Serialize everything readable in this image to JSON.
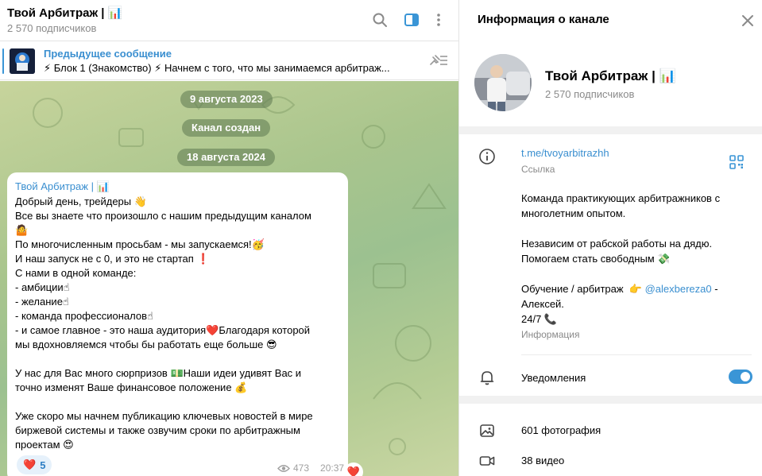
{
  "chat": {
    "title": "Твой Арбитраж | 📊",
    "subscribers": "2 570 подписчиков",
    "header_icons": [
      "search-icon",
      "sidebar-toggle-icon",
      "more-vertical-icon"
    ]
  },
  "pinned": {
    "title": "Предыдущее сообщение",
    "text": "⚡ Блок 1 (Знакомство) ⚡  Начнем с того, что мы занимаемся арбитраж..."
  },
  "service_messages": [
    "9 августа 2023",
    "Канал создан",
    "18 августа 2024"
  ],
  "post": {
    "author": "Твой Арбитраж | 📊",
    "lines": [
      "Добрый день, трейдеры 👋",
      "Все вы знаете что произошло с нашим предыдущим каналом",
      "🤷",
      "По многочисленным просьбам - мы запускаемся!🥳",
      "И наш запуск не с 0, и это не стартап ❗",
      "С нами в одной команде:",
      "- амбиции☝",
      "- желание☝",
      "- команда профессионалов☝",
      "- и самое главное - это наша аудитория❤️Благодаря которой",
      "мы вдохновляемся чтобы бы работать еще больше 😎",
      "",
      "У нас для Вас много сюрпризов 💵Наши идеи удивят Вас и",
      "точно изменят Ваше финансовое положение 💰",
      "",
      "Уже скоро мы начнем публикацию ключевых новостей в мире",
      "биржевой системы и также озвучим сроки по арбитражным",
      "проектам 😍"
    ],
    "reaction_emoji": "❤️",
    "reaction_count": "5",
    "views": "473",
    "time": "20:37"
  },
  "info": {
    "title": "Информация о канале",
    "name": "Твой Арбитраж | 📊",
    "subscribers": "2 570 подписчиков",
    "link": "t.me/tvoyarbitrazhh",
    "link_label": "Ссылка",
    "description_lines": [
      "Команда практикующих арбитражников с",
      "многолетним опытом.",
      "",
      "Независим от рабской работы на дядю.",
      "Помогаем стать свободным 💸",
      "",
      "Обучение / арбитраж  👉 ",
      "Алексей.",
      "24/7 📞"
    ],
    "mention": "@alexbereza0",
    "mention_suffix": " -",
    "description_label": "Информация",
    "notifications_label": "Уведомления",
    "notifications_on": true,
    "photos_label": "601 фотография",
    "videos_label": "38 видео"
  },
  "colors": {
    "accent": "#3a95d6",
    "link": "#3a8fd0",
    "muted": "#8a8a8a",
    "reaction_bg": "#e6f1fb"
  }
}
